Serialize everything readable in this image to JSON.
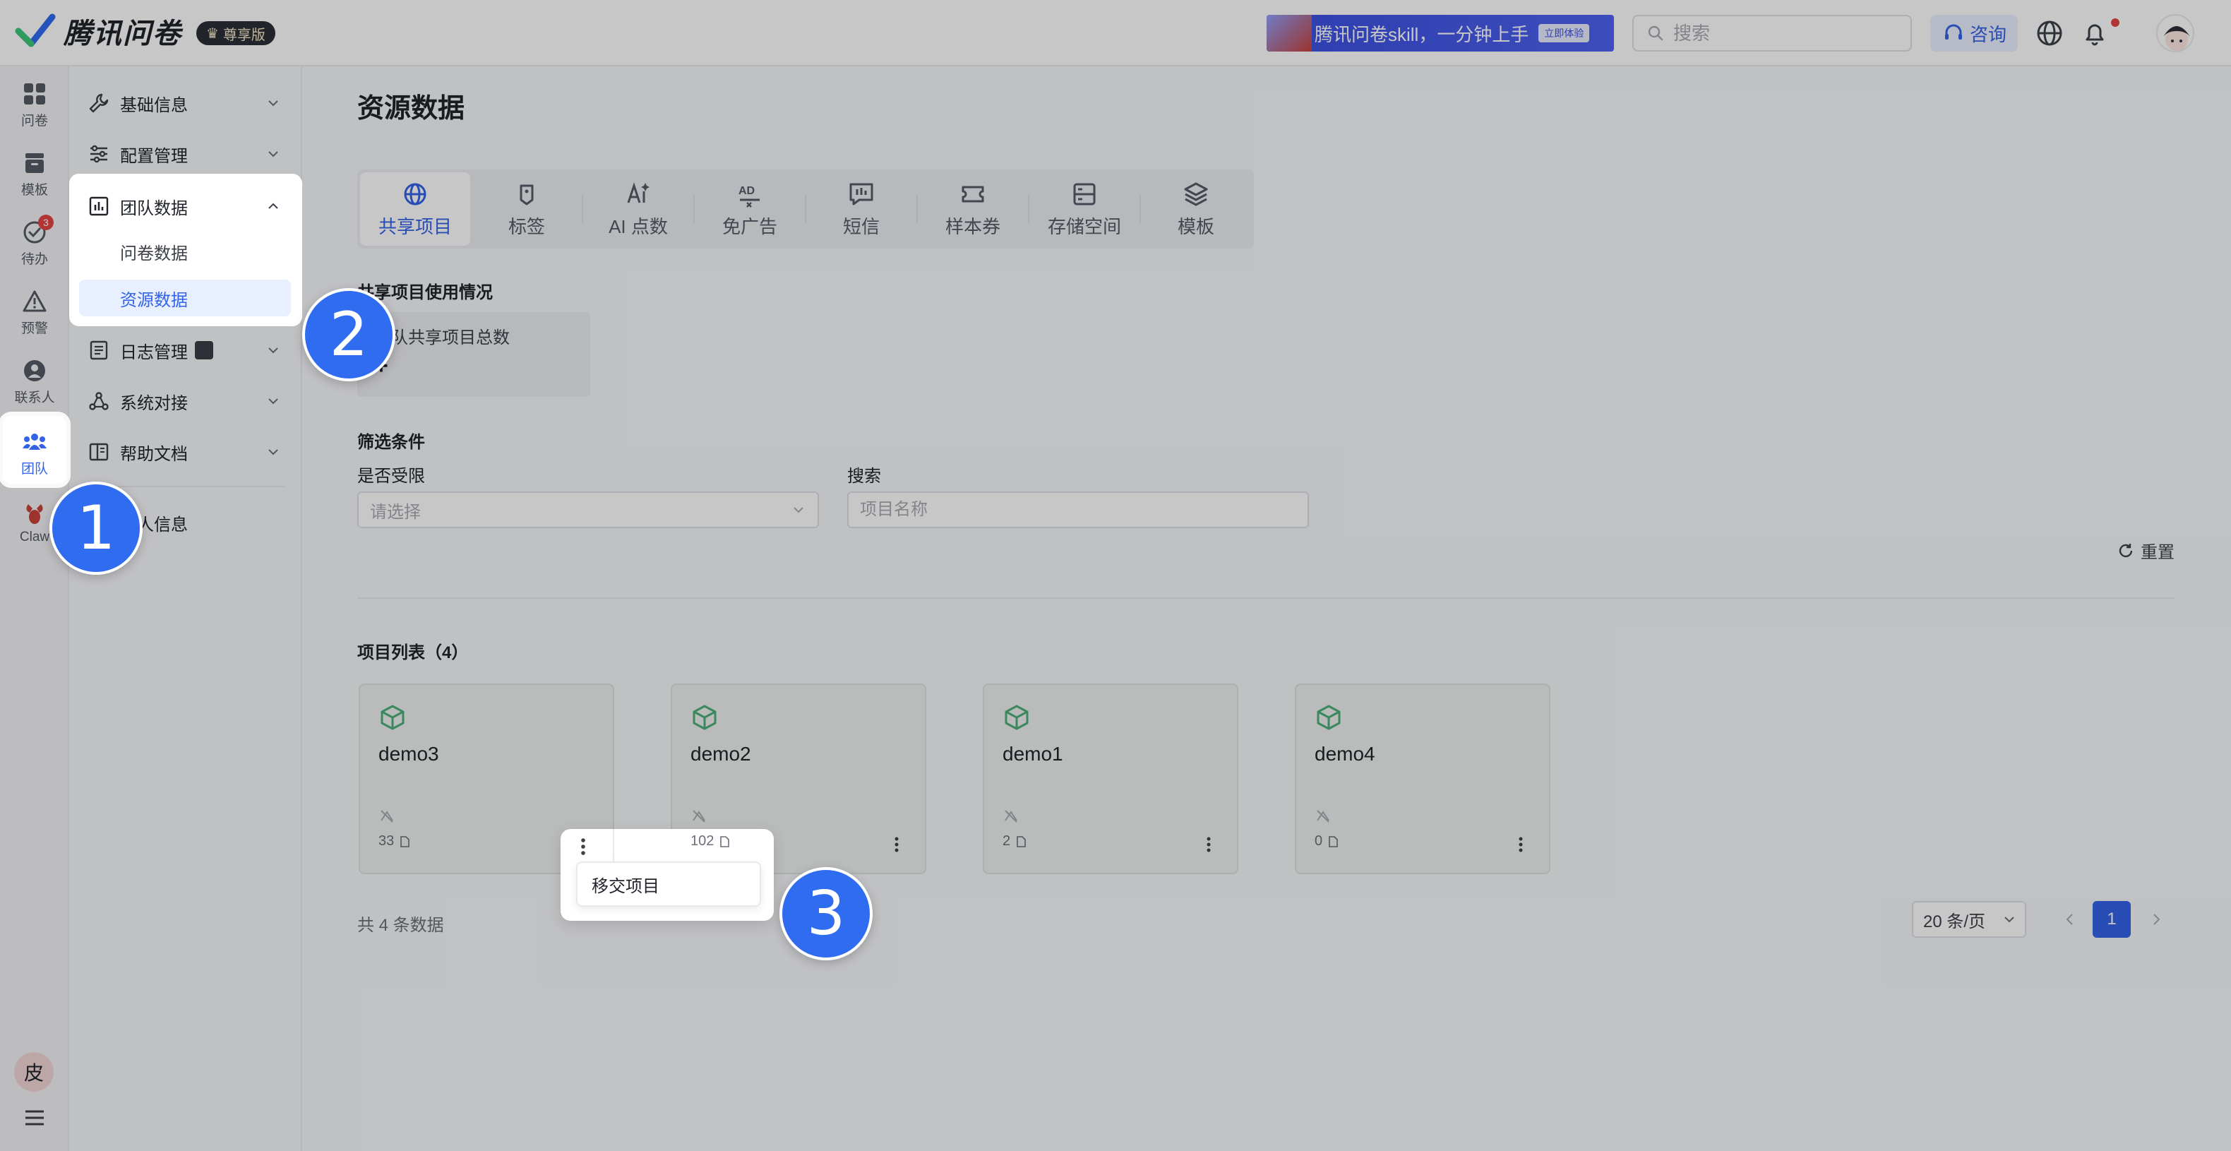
{
  "app": {
    "title": "腾讯问卷",
    "edition": "尊享版"
  },
  "topbar": {
    "promo_text": "腾讯问卷skill，一分钟上手",
    "promo_button": "立即体验",
    "search_placeholder": "搜索",
    "consult_label": "咨询"
  },
  "rail": {
    "items": [
      {
        "label": "问卷",
        "icon": "grid-icon"
      },
      {
        "label": "模板",
        "icon": "archive-icon"
      },
      {
        "label": "待办",
        "icon": "check-circle-icon",
        "badge": "3"
      },
      {
        "label": "预警",
        "icon": "warning-icon"
      },
      {
        "label": "联系人",
        "icon": "person-icon"
      },
      {
        "label": "团队",
        "icon": "team-icon"
      },
      {
        "label": "Claw",
        "icon": "claw-icon"
      }
    ],
    "user_avatar": "皮"
  },
  "nav": {
    "items": [
      {
        "label": "基础信息"
      },
      {
        "label": "配置管理"
      },
      {
        "label": "团队数据"
      },
      {
        "label": "日志管理"
      },
      {
        "label": "系统对接"
      },
      {
        "label": "帮助文档"
      },
      {
        "label": "个人信息"
      }
    ],
    "sub_items": [
      {
        "label": "问卷数据"
      },
      {
        "label": "资源数据"
      }
    ]
  },
  "main": {
    "title": "资源数据",
    "tabs": [
      {
        "label": "共享项目",
        "icon": "globe-icon"
      },
      {
        "label": "标签",
        "icon": "tag-icon"
      },
      {
        "label": "AI 点数",
        "icon": "ai-icon"
      },
      {
        "label": "免广告",
        "icon": "no-ad-icon"
      },
      {
        "label": "短信",
        "icon": "message-icon"
      },
      {
        "label": "样本券",
        "icon": "ticket-icon"
      },
      {
        "label": "存储空间",
        "icon": "storage-icon"
      },
      {
        "label": "模板",
        "icon": "layers-icon"
      }
    ],
    "usage_title": "共享项目使用情况",
    "usage_card": {
      "label": "团队共享项目总数",
      "value": "+"
    },
    "filter_title": "筛选条件",
    "filter_limited_label": "是否受限",
    "filter_limited_placeholder": "请选择",
    "filter_search_label": "搜索",
    "filter_search_placeholder": "项目名称",
    "reset_label": "重置",
    "list_title": "项目列表（4）",
    "projects": [
      {
        "name": "demo3",
        "count": "33"
      },
      {
        "name": "demo2",
        "count": "102"
      },
      {
        "name": "demo1",
        "count": "2"
      },
      {
        "name": "demo4",
        "count": "0"
      }
    ],
    "total_text": "共 4 条数据",
    "page_size": "20 条/页",
    "current_page": "1",
    "context_menu_item": "移交项目"
  },
  "steps": [
    "1",
    "2",
    "3"
  ],
  "colors": {
    "accent": "#3463e8",
    "step": "#2f6cf0",
    "cube": "#4caf7a"
  }
}
